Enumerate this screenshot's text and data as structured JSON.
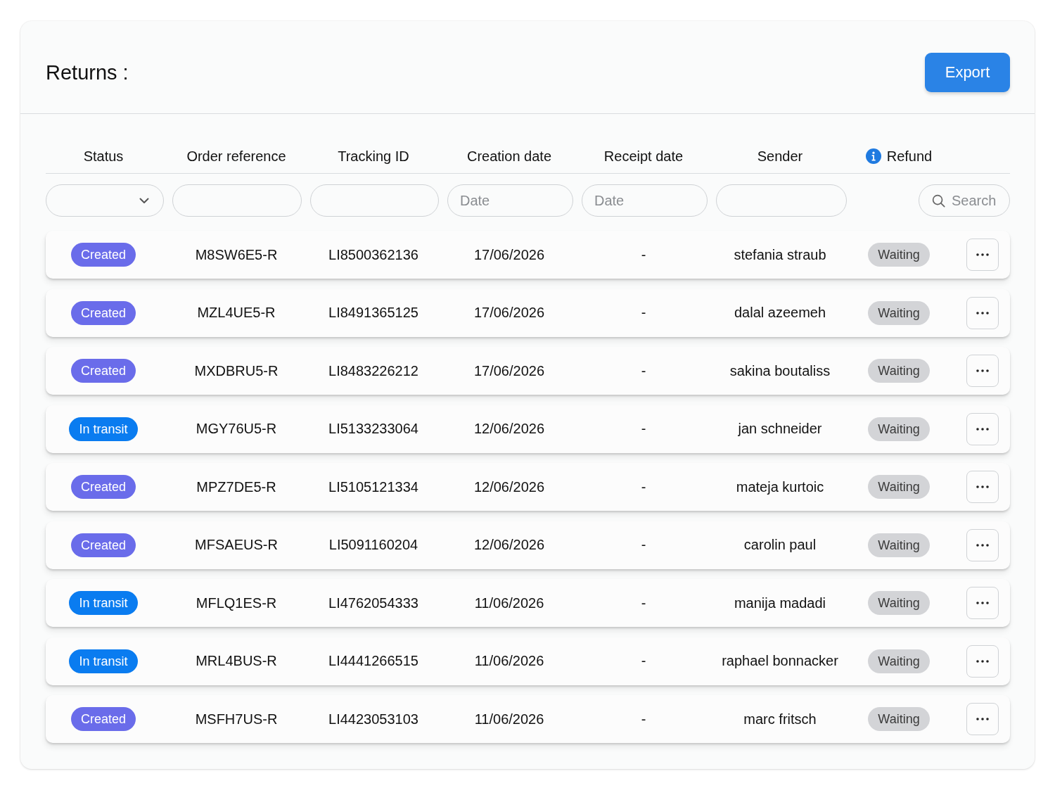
{
  "header": {
    "title": "Returns :",
    "export_button": "Export"
  },
  "table": {
    "columns": [
      {
        "label": "Status",
        "kind": "plain"
      },
      {
        "label": "Order reference",
        "kind": "plain"
      },
      {
        "label": "Tracking ID",
        "kind": "plain"
      },
      {
        "label": "Creation date",
        "kind": "plain"
      },
      {
        "label": "Receipt date",
        "kind": "plain"
      },
      {
        "label": "Sender",
        "kind": "plain"
      },
      {
        "label": "Refund",
        "kind": "info"
      }
    ],
    "filters": [
      {
        "kind": "select"
      },
      {
        "kind": "text"
      },
      {
        "kind": "text"
      },
      {
        "kind": "date",
        "placeholder": "Date"
      },
      {
        "kind": "date",
        "placeholder": "Date"
      },
      {
        "kind": "text"
      },
      {
        "kind": "search",
        "placeholder": "Search"
      }
    ],
    "rows": [
      {
        "status": {
          "label": "Created",
          "color": "#6a6cea"
        },
        "order_reference": "M8SW6E5-R",
        "tracking_id": "LI8500362136",
        "creation_date": "17/06/2026",
        "receipt_date": "-",
        "sender": "stefania straub",
        "refund": "Waiting"
      },
      {
        "status": {
          "label": "Created",
          "color": "#6a6cea"
        },
        "order_reference": "MZL4UE5-R",
        "tracking_id": "LI8491365125",
        "creation_date": "17/06/2026",
        "receipt_date": "-",
        "sender": "dalal azeemeh",
        "refund": "Waiting"
      },
      {
        "status": {
          "label": "Created",
          "color": "#6a6cea"
        },
        "order_reference": "MXDBRU5-R",
        "tracking_id": "LI8483226212",
        "creation_date": "17/06/2026",
        "receipt_date": "-",
        "sender": "sakina boutaliss",
        "refund": "Waiting"
      },
      {
        "status": {
          "label": "In transit",
          "color": "#0a7cf0"
        },
        "order_reference": "MGY76U5-R",
        "tracking_id": "LI5133233064",
        "creation_date": "12/06/2026",
        "receipt_date": "-",
        "sender": "jan schneider",
        "refund": "Waiting"
      },
      {
        "status": {
          "label": "Created",
          "color": "#6a6cea"
        },
        "order_reference": "MPZ7DE5-R",
        "tracking_id": "LI5105121334",
        "creation_date": "12/06/2026",
        "receipt_date": "-",
        "sender": "mateja kurtoic",
        "refund": "Waiting"
      },
      {
        "status": {
          "label": "Created",
          "color": "#6a6cea"
        },
        "order_reference": "MFSAEUS-R",
        "tracking_id": "LI5091160204",
        "creation_date": "12/06/2026",
        "receipt_date": "-",
        "sender": "carolin paul",
        "refund": "Waiting"
      },
      {
        "status": {
          "label": "In transit",
          "color": "#0a7cf0"
        },
        "order_reference": "MFLQ1ES-R",
        "tracking_id": "LI4762054333",
        "creation_date": "11/06/2026",
        "receipt_date": "-",
        "sender": "manija madadi",
        "refund": "Waiting"
      },
      {
        "status": {
          "label": "In transit",
          "color": "#0a7cf0"
        },
        "order_reference": "MRL4BUS-R",
        "tracking_id": "LI4441266515",
        "creation_date": "11/06/2026",
        "receipt_date": "-",
        "sender": "raphael bonnacker",
        "refund": "Waiting"
      },
      {
        "status": {
          "label": "Created",
          "color": "#6a6cea"
        },
        "order_reference": "MSFH7US-R",
        "tracking_id": "LI4423053103",
        "creation_date": "11/06/2026",
        "receipt_date": "-",
        "sender": "marc fritsch",
        "refund": "Waiting"
      }
    ]
  }
}
